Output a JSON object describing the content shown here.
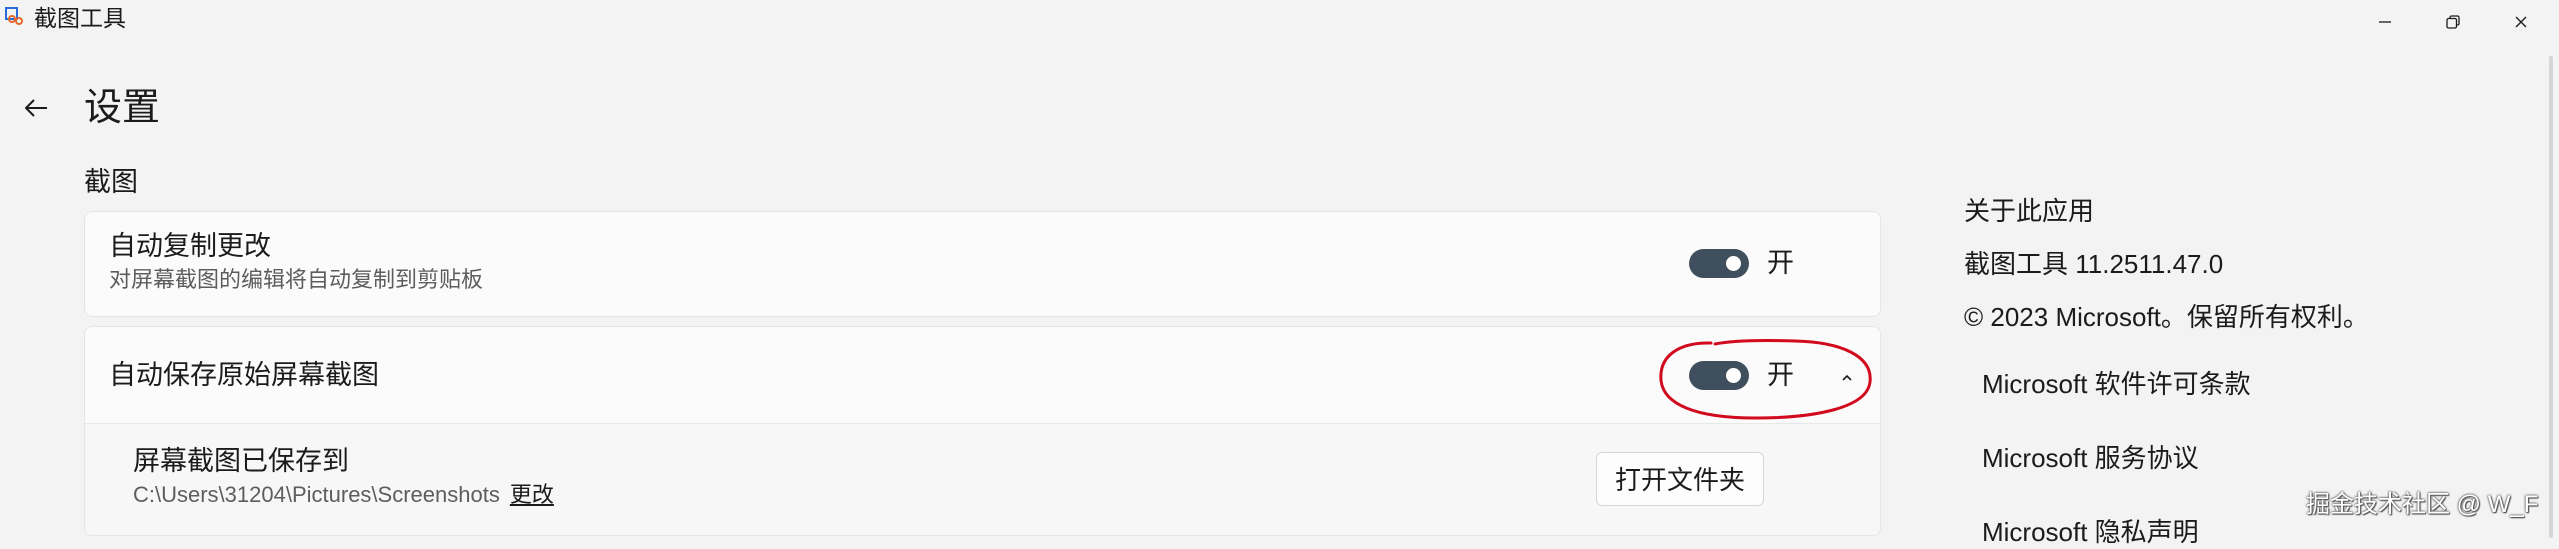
{
  "window": {
    "title": "截图工具",
    "app_icon": "snipping-tool-icon",
    "controls": [
      "minimize-icon",
      "restore-icon",
      "close-icon"
    ]
  },
  "header": {
    "back_icon": "back-arrow-icon",
    "title": "设置"
  },
  "section": {
    "title": "截图"
  },
  "settings": {
    "auto_copy": {
      "title": "自动复制更改",
      "description": "对屏幕截图的编辑将自动复制到剪贴板",
      "toggle_on": true,
      "toggle_label": "开"
    },
    "auto_save": {
      "title": "自动保存原始屏幕截图",
      "toggle_on": true,
      "toggle_label": "开",
      "expanded": true,
      "chevron_icon": "chevron-up-icon",
      "saved_to": {
        "title": "屏幕截图已保存到",
        "path": "C:\\Users\\31204\\Pictures\\Screenshots",
        "change_link": "更改",
        "open_folder_button": "打开文件夹"
      }
    }
  },
  "about": {
    "title": "关于此应用",
    "version": "截图工具 11.2511.47.0",
    "copyright": "© 2023 Microsoft。保留所有权利。",
    "links": [
      "Microsoft 软件许可条款",
      "Microsoft 服务协议",
      "Microsoft 隐私声明"
    ]
  },
  "watermark": "掘金技术社区 @ W_F",
  "colors": {
    "background": "#f3f3f3",
    "card": "#fbfbfb",
    "toggle_on": "#3f4f5e",
    "annotation": "#d10a1e"
  }
}
